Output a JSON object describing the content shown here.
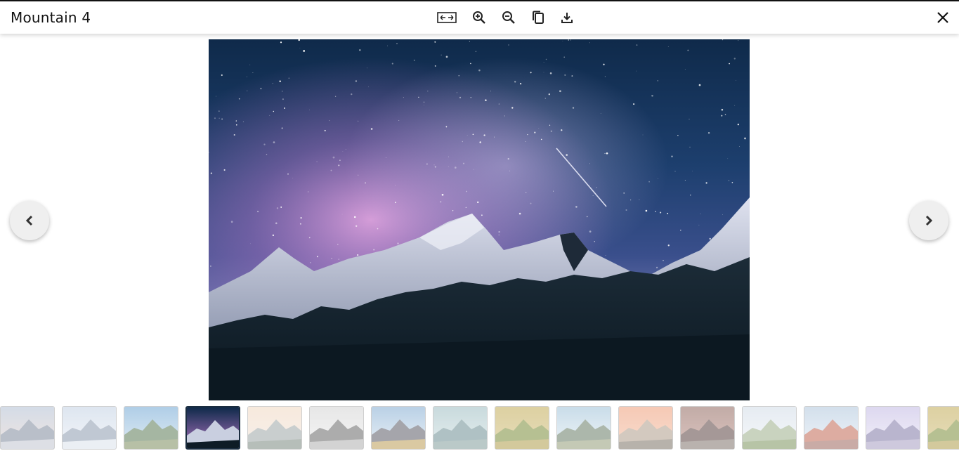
{
  "viewer": {
    "title": "Mountain 4",
    "current_index": 4,
    "toolbar": {
      "fit_icon": "fit-width-icon",
      "zoom_in_icon": "zoom-in-icon",
      "zoom_out_icon": "zoom-out-icon",
      "copy_icon": "copy-icon",
      "download_icon": "download-icon",
      "close_icon": "close-icon"
    },
    "nav": {
      "prev_icon": "chevron-left-icon",
      "next_icon": "chevron-right-icon"
    },
    "thumbnails": [
      {
        "name": "thumbnail-1",
        "active": false
      },
      {
        "name": "thumbnail-2",
        "active": false
      },
      {
        "name": "thumbnail-3",
        "active": false
      },
      {
        "name": "thumbnail-4",
        "active": true
      },
      {
        "name": "thumbnail-5",
        "active": false
      },
      {
        "name": "thumbnail-6",
        "active": false
      },
      {
        "name": "thumbnail-7",
        "active": false
      },
      {
        "name": "thumbnail-8",
        "active": false
      },
      {
        "name": "thumbnail-9",
        "active": false
      },
      {
        "name": "thumbnail-10",
        "active": false
      },
      {
        "name": "thumbnail-11",
        "active": false
      },
      {
        "name": "thumbnail-12",
        "active": false
      },
      {
        "name": "thumbnail-13",
        "active": false
      },
      {
        "name": "thumbnail-14",
        "active": false
      },
      {
        "name": "thumbnail-15",
        "active": false
      },
      {
        "name": "thumbnail-16",
        "active": false
      }
    ]
  },
  "colors": {
    "sky_top": "#0f2a4a",
    "sky_mid": "#3a4f8c",
    "glow": "#d08cd0",
    "snow": "#c9cfe0",
    "forest": "#0e1c26",
    "active_border": "#1b2d40"
  }
}
